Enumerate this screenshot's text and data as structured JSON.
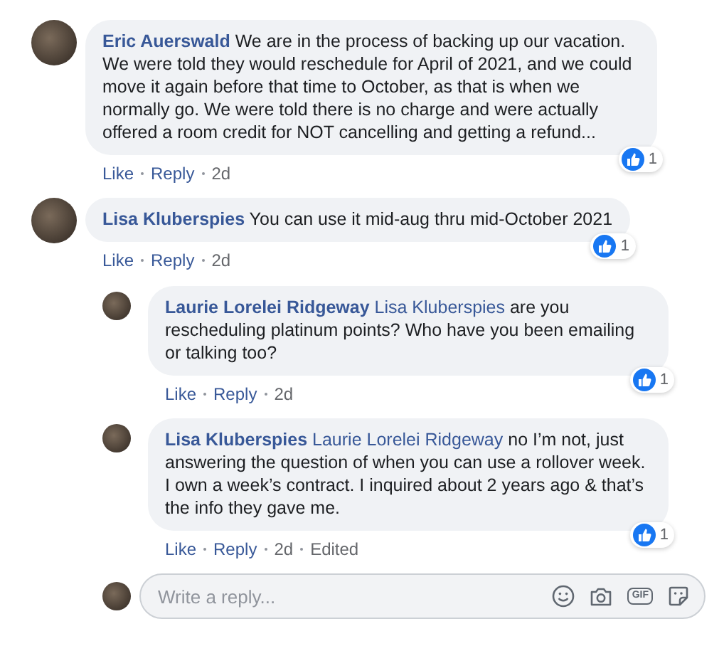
{
  "comments": [
    {
      "author": "Eric Auerswald",
      "text": "We are in the process of backing up our vacation. We were told they would reschedule for April of 2021, and we could move it again before that time to October, as that is when we normally go. We were told there is no charge and were actually offered a room credit for NOT cancelling and getting a refund...",
      "reactions": "1",
      "actions": [
        "Like",
        "Reply"
      ],
      "time": "2d"
    },
    {
      "author": "Lisa Kluberspies",
      "text": "You can use it mid-aug thru mid-October 2021",
      "reactions": "1",
      "actions": [
        "Like",
        "Reply"
      ],
      "time": "2d",
      "children": [
        {
          "author": "Laurie Lorelei Ridgeway",
          "mention": "Lisa Kluberspies",
          "text": "are you rescheduling platinum points? Who have you been emailing or talking too?",
          "reactions": "1",
          "actions": [
            "Like",
            "Reply"
          ],
          "time": "2d"
        },
        {
          "author": "Lisa Kluberspies",
          "mention": "Laurie Lorelei Ridgeway",
          "text": "no I’m not, just answering the question of when you can use a rollover week. I own a week’s contract. I inquired about 2 years ago & that’s the info they gave me.",
          "reactions": "1",
          "actions": [
            "Like",
            "Reply"
          ],
          "time": "2d",
          "edited": "Edited"
        }
      ]
    }
  ],
  "reply_box": {
    "placeholder": "Write a reply...",
    "gif_label": "GIF"
  }
}
